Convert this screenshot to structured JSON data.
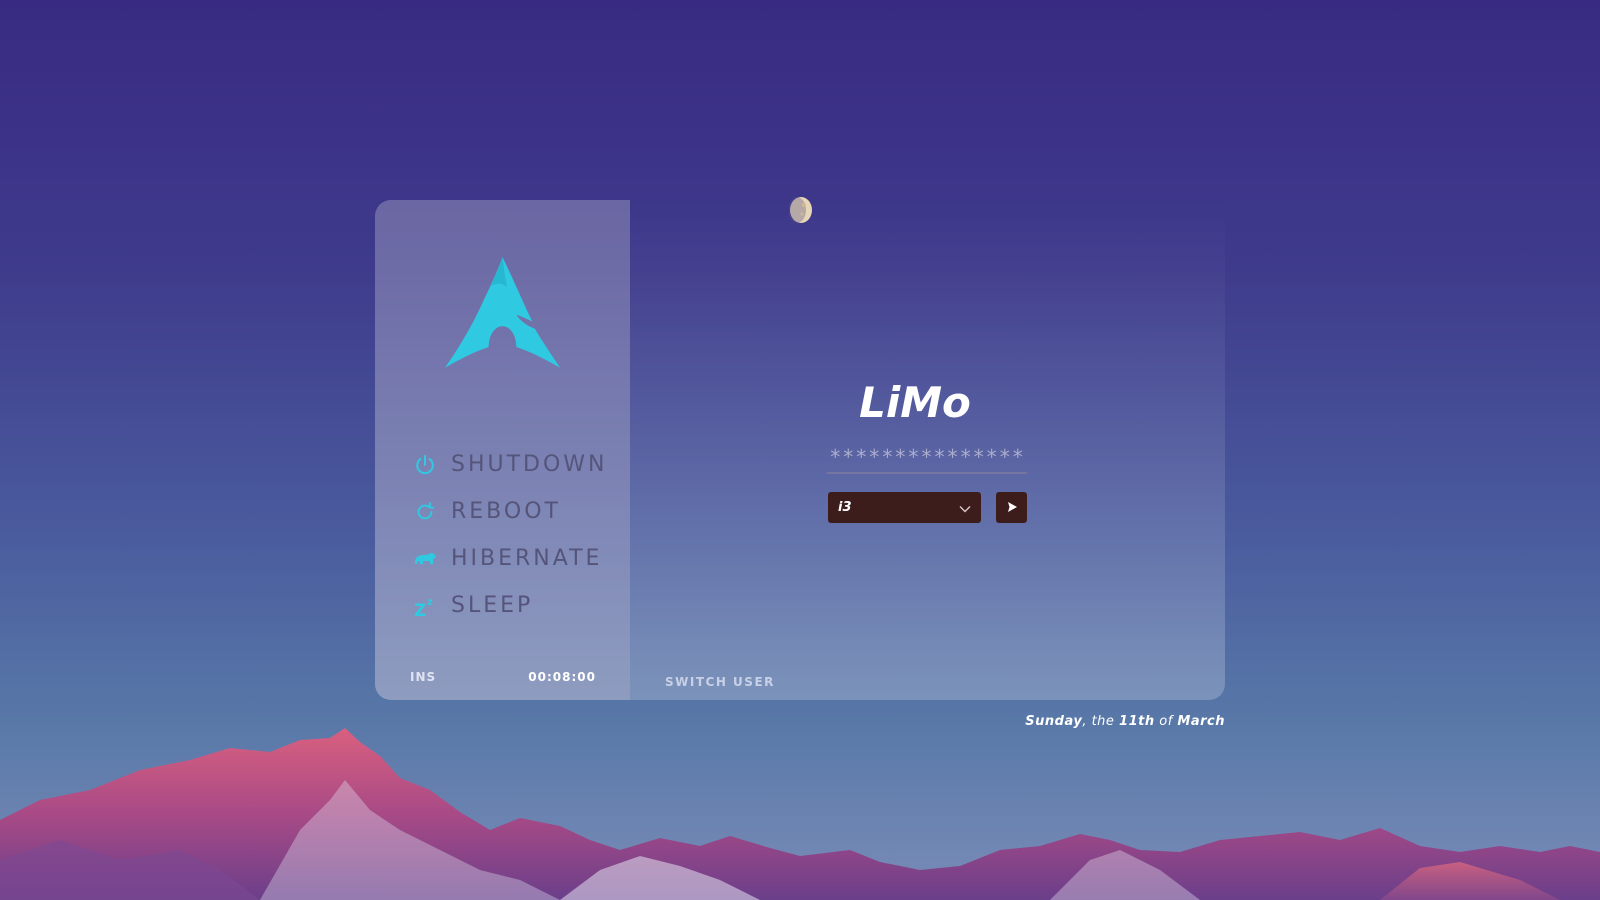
{
  "power_menu": {
    "items": [
      {
        "label": "SHUTDOWN",
        "icon": "power-icon"
      },
      {
        "label": "REBOOT",
        "icon": "reboot-icon"
      },
      {
        "label": "HIBERNATE",
        "icon": "bear-icon"
      },
      {
        "label": "SLEEP",
        "icon": "sleep-icon"
      }
    ]
  },
  "status": {
    "keyboard_mode": "INS",
    "clock": "00:08:00"
  },
  "login": {
    "username": "LiMo",
    "password_mask": "***************",
    "session": "i3",
    "switch_user_label": "SWITCH USER"
  },
  "date": {
    "weekday": "Sunday",
    "sep1": ", the ",
    "day": "11th",
    "sep2": " of ",
    "month": "March"
  },
  "colors": {
    "accent": "#2fc9e1",
    "button_bg": "#3d1d1c",
    "label": "#55547a"
  }
}
